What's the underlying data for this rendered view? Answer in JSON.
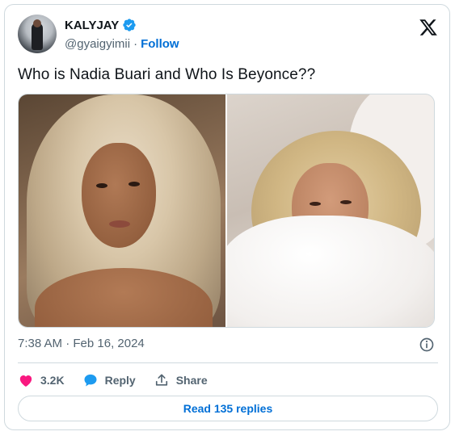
{
  "author": {
    "name": "KALYJAY",
    "handle": "@gyaigyimii",
    "separator": "·",
    "follow_label": "Follow"
  },
  "tweet": {
    "text": "Who is Nadia Buari and Who Is Beyonce??",
    "timestamp": "7:38 AM · Feb 16, 2024"
  },
  "media": [
    {
      "description_icon": "photo-left"
    },
    {
      "description_icon": "photo-right"
    }
  ],
  "actions": {
    "likes_count": "3.2K",
    "reply_label": "Reply",
    "share_label": "Share"
  },
  "read_replies_label": "Read 135 replies",
  "colors": {
    "accent": "#006fd6",
    "like": "#f91880",
    "reply_icon": "#1d9bf0",
    "text_secondary": "#536471",
    "border": "#cfd9de"
  }
}
